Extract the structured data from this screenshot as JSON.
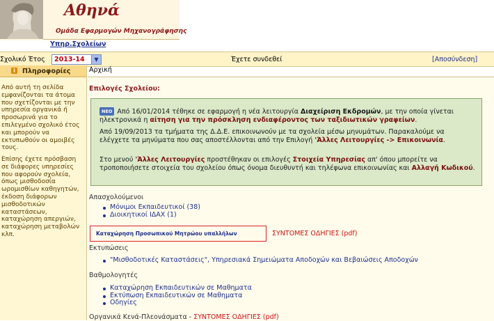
{
  "header": {
    "title": "Αθηνά",
    "subtitle": "Ομάδα Εφαρμογών Μηχανογράφησης",
    "services_link": "Υπηρ.Σχολείων"
  },
  "topbar": {
    "school_year_label": "Σχολικό Έτος",
    "school_year_value": "2013-14",
    "connected_text": "Έχετε συνδεθεί",
    "logout": "[Αποσύνδεση]"
  },
  "sidebar": {
    "title": "Πληροφορίες",
    "paragraph1": "Από αυτή τη σελίδα εμφανίζονται τα άτομα που σχετίζονται με την υπηρεσία οργανικά ή προσωρινά για το επιλεγμένο σχολικό έτος και μπορούν να εκτυπωθούν οι αμοιβές τους.",
    "paragraph2": "Επίσης έχετε πρόσβαση σε διάφορες υπηρεσίες που αφορούν σχολεία, όπως μισθοδοσία ωρομισθίων καθηγητών, έκδοση διάφορων μισθοδοτικών καταστάσεων, καταχώρηση απεργιών, καταχώρηση μεταβολών κλπ."
  },
  "breadcrumb": "Αρχική",
  "main": {
    "section_title": "Επιλογές Σχολείου:",
    "notice": {
      "badge": "NEO",
      "p1_a": "Από 16/01/2014 τέθηκε σε εφαρμογή η νέα λειτουργία ",
      "p1_b": "Διαχείριση Εκδρομών",
      "p1_c": ", με την οποία γίνεται ηλεκτρονικά η ",
      "p1_d": "αίτηση για την πρόσκληση ενδιαφέροντος των ταξιδιωτικών γραφείων",
      "p1_e": ".",
      "p2_a": "Από 19/09/2013 τα τμήματα της Δ.Δ.Ε. επικοινωνούν με τα σχολεία μέσω μηνυμάτων. Παρακαλούμε να ελέγχετε τα μηνύματα που σας αποστέλλονται από την Επιλογή ",
      "p2_b": "'Άλλες Λειτουργίες -> Επικοινωνία",
      "p2_c": ".",
      "p3_a": "Στο μενού ",
      "p3_b": "'Άλλες Λειτουργίες",
      "p3_c": " προστέθηκαν οι επιλογές ",
      "p3_d": "Στοιχεία Υπηρεσίας",
      "p3_e": " απ' όπου μπορείτε να τροποποιήσετε στοιχεία του σχολείου όπως όνομα διευθυντή και τηλέφωνα επικοινωνίας και ",
      "p3_f": "Αλλαγή Κωδικού",
      "p3_g": "."
    },
    "staff": {
      "label": "Απασχολούμενοι",
      "items": [
        "Μόνιμοι Εκπαιδευτικοί (38)",
        "Διοικητικοί ΙΔΑΧ (1)"
      ]
    },
    "registry": {
      "link": "Καταχώρηση Προσωπικού Μητρώου υπαλλήλων",
      "guide": "ΣΥΝΤΟΜΕΣ ΟΔΗΓΙΕΣ (pdf)"
    },
    "prints": {
      "label": "Εκτυπώσεις",
      "items": [
        "\"Μισθοδοτικές Καταστάσεις\", Υπηρεσιακά Σημειώματα Αποδοχών και Βεβαιώσεις Αποδοχών"
      ]
    },
    "grades": {
      "label": "Βαθμολογητές",
      "items": [
        "Καταχώρηση Εκπαιδευτικών σε Μαθηματα",
        "Εκτύπωση Εκπαιδευτικών σε Μαθηματα",
        "Οδηγίες"
      ]
    },
    "vacancies": {
      "label": "Οργανικά Κενά-Πλεονάσματα - ",
      "guide": "ΣΥΝΤΟΜΕΣ ΟΔΗΓΙΕΣ (pdf)"
    }
  }
}
